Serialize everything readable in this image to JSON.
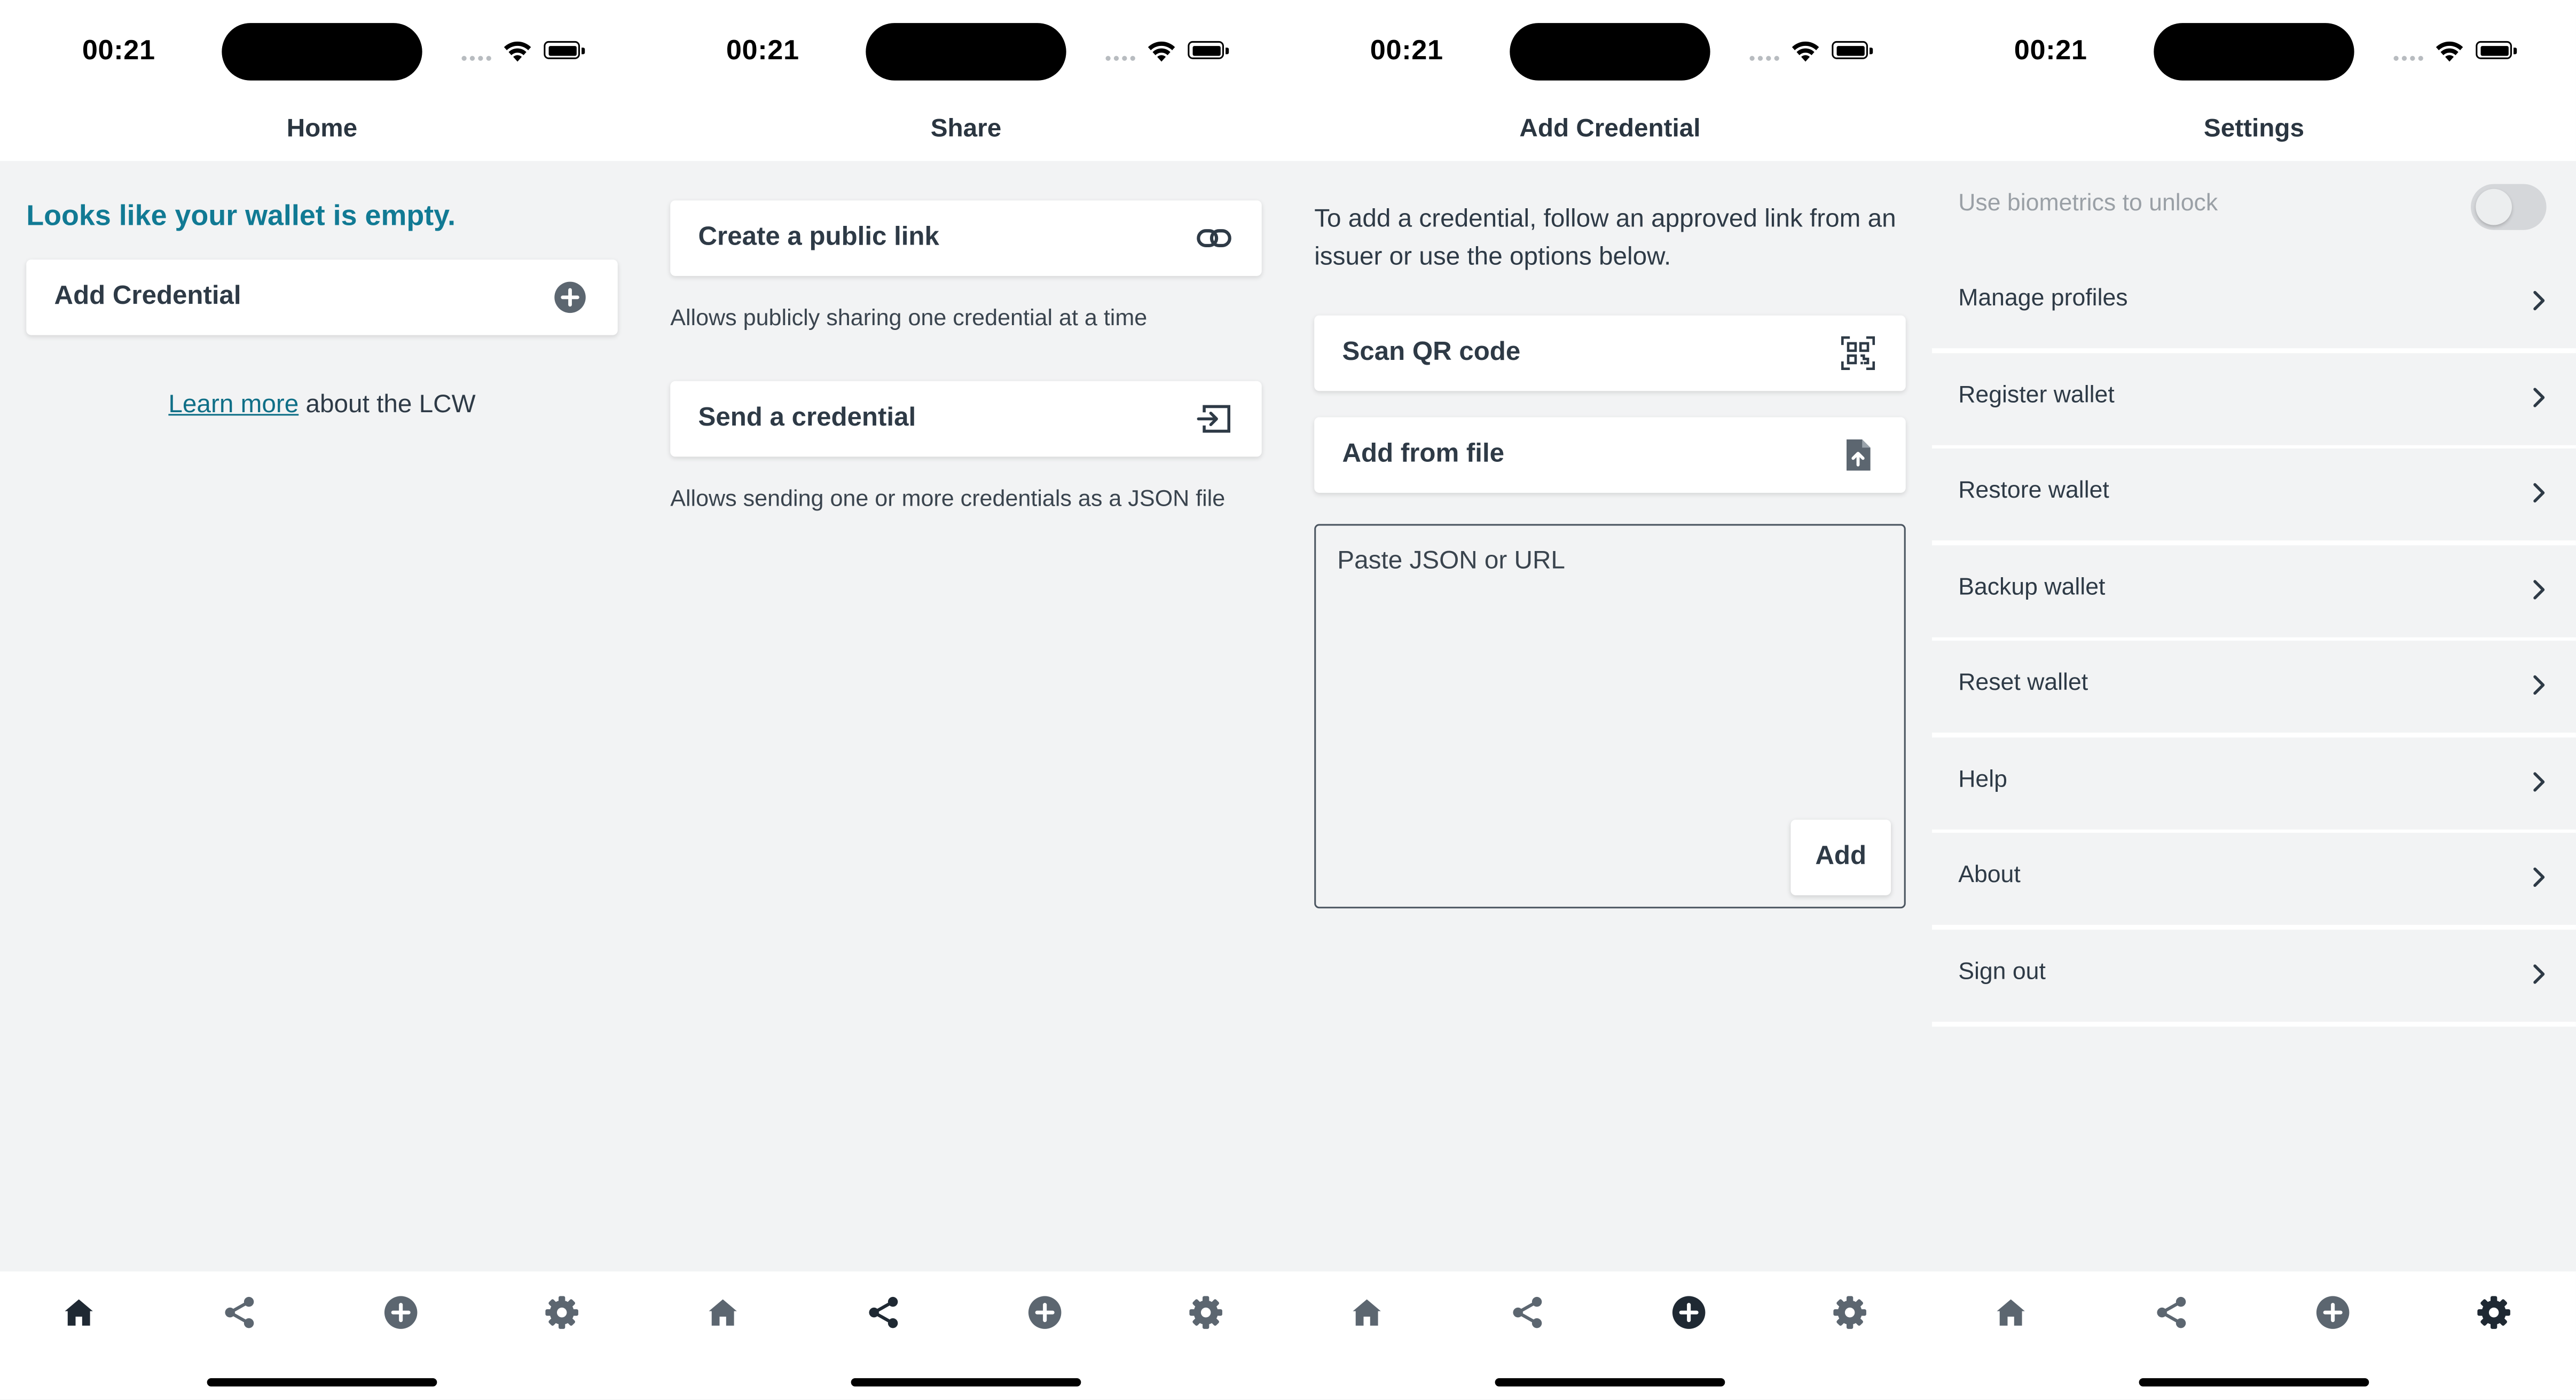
{
  "status": {
    "time": "00:21"
  },
  "colors": {
    "accent": "#117a94",
    "link": "#0f6f87",
    "tab_active": "#1f2933",
    "tab_inactive": "#5c6670",
    "background": "#f2f3f4"
  },
  "tabs": [
    {
      "name": "home",
      "icon": "home-icon"
    },
    {
      "name": "share",
      "icon": "share-icon"
    },
    {
      "name": "add",
      "icon": "plus-circle-icon"
    },
    {
      "name": "settings",
      "icon": "gear-icon"
    }
  ],
  "home": {
    "title": "Home",
    "empty_heading": "Looks like your wallet is empty.",
    "add_button": {
      "label": "Add Credential",
      "icon": "plus-circle-icon"
    },
    "learn_more_link": "Learn more",
    "learn_more_suffix": " about the LCW"
  },
  "share": {
    "title": "Share",
    "items": [
      {
        "label": "Create a public link",
        "icon": "link-icon",
        "hint": "Allows publicly sharing one credential at a time"
      },
      {
        "label": "Send a credential",
        "icon": "send-icon",
        "hint": "Allows sending one or more credentials as a JSON file"
      }
    ]
  },
  "add": {
    "title": "Add Credential",
    "intro": "To add a credential, follow an approved link from an issuer or use the options below.",
    "options": [
      {
        "label": "Scan QR code",
        "icon": "qr-scan-icon"
      },
      {
        "label": "Add from file",
        "icon": "file-upload-icon"
      }
    ],
    "paste_placeholder": "Paste JSON or URL",
    "add_label": "Add"
  },
  "settings": {
    "title": "Settings",
    "biometrics_label": "Use biometrics to unlock",
    "biometrics_enabled": false,
    "items": [
      "Manage profiles",
      "Register wallet",
      "Restore wallet",
      "Backup wallet",
      "Reset wallet",
      "Help",
      "About",
      "Sign out"
    ]
  }
}
